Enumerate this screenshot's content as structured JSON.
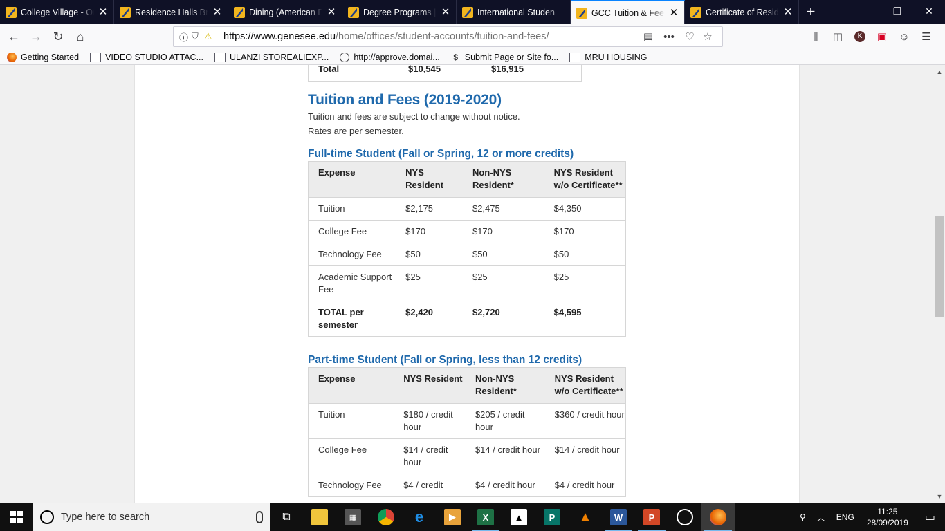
{
  "browser": {
    "tabs": [
      {
        "title": "College Village - On",
        "active": false
      },
      {
        "title": "Residence Halls Bre",
        "active": false
      },
      {
        "title": "Dining (American D",
        "active": false
      },
      {
        "title": "Degree Programs | S",
        "active": false
      },
      {
        "title": "International Studen",
        "active": false
      },
      {
        "title": "GCC Tuition & Fees",
        "active": true
      },
      {
        "title": "Certificate of Reside",
        "active": false
      }
    ],
    "url_host": "https://www.genesee.edu",
    "url_path": "/home/offices/student-accounts/tuition-and-fees/",
    "bookmarks": [
      {
        "label": "Getting Started",
        "icon": "firefox-icon"
      },
      {
        "label": "VIDEO STUDIO ATTAC...",
        "icon": "folder-icon"
      },
      {
        "label": "ULANZI STOREALIEXP...",
        "icon": "folder-icon"
      },
      {
        "label": "http://approve.domai...",
        "icon": "globe-icon"
      },
      {
        "label": "Submit Page or Site fo...",
        "icon": "dollar-icon"
      },
      {
        "label": "MRU HOUSING",
        "icon": "folder-icon"
      }
    ],
    "profile_initial": "K"
  },
  "page": {
    "prev_total": {
      "label": "Total",
      "nys": "$10,545",
      "non_nys": "$16,915"
    },
    "heading": "Tuition and Fees (2019-2020)",
    "note1": "Tuition and fees are subject to change without notice.",
    "note2": "Rates are per semester.",
    "fulltime": {
      "title": "Full-time Student (Fall or Spring, 12 or more credits)",
      "headers": [
        "Expense",
        "NYS Resident",
        "Non-NYS Resident*",
        "NYS Resident w/o Certificate**"
      ],
      "rows": [
        [
          "Tuition",
          "$2,175",
          "$2,475",
          "$4,350"
        ],
        [
          "College Fee",
          "$170",
          "$170",
          "$170"
        ],
        [
          "Technology Fee",
          "$50",
          "$50",
          "$50"
        ],
        [
          "Academic Support Fee",
          "$25",
          "$25",
          "$25"
        ]
      ],
      "total": [
        "TOTAL per semester",
        "$2,420",
        "$2,720",
        "$4,595"
      ]
    },
    "parttime": {
      "title": "Part-time Student (Fall or Spring, less than 12 credits)",
      "headers": [
        "Expense",
        "NYS Resident",
        "Non-NYS Resident*",
        "NYS Resident w/o Certificate**"
      ],
      "rows": [
        [
          "Tuition",
          "$180 / credit hour",
          "$205 / credit hour",
          "$360 / credit hour"
        ],
        [
          "College Fee",
          "$14 / credit hour",
          "$14 / credit hour",
          "$14 / credit hour"
        ],
        [
          "Technology Fee",
          "$4 / credit",
          "$4 / credit hour",
          "$4 / credit hour"
        ]
      ]
    }
  },
  "taskbar": {
    "search_placeholder": "Type here to search",
    "lang": "ENG",
    "time": "11:25",
    "date": "28/09/2019"
  },
  "colors": {
    "accent": "#0a84ff",
    "heading": "#1f69ac",
    "tabbar": "#0f1126"
  }
}
